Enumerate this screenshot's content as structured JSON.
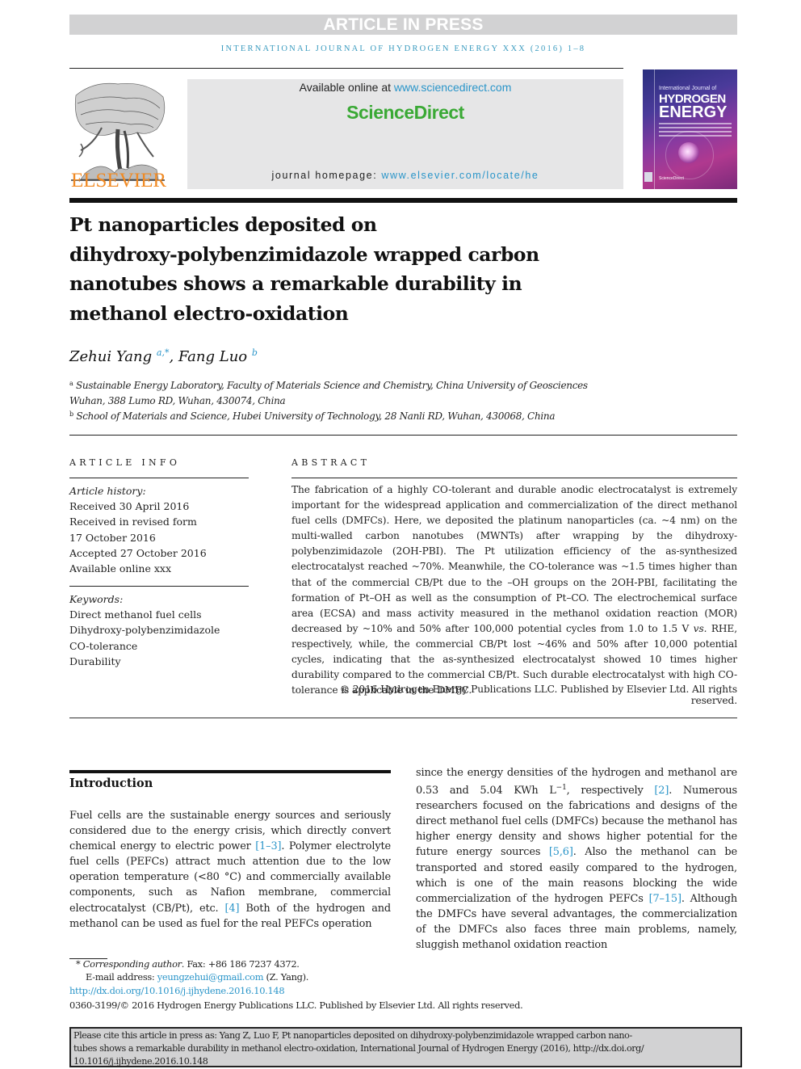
{
  "banner": {
    "text": "ARTICLE IN PRESS"
  },
  "running_header": {
    "text": "INTERNATIONAL JOURNAL OF HYDROGEN ENERGY XXX (2016) 1–8"
  },
  "publisher": {
    "logo_text": "ELSEVIER",
    "available_online_prefix": "Available online at ",
    "available_online_link": "www.sciencedirect.com",
    "brand": "ScienceDirect",
    "homepage_prefix": "journal homepage: ",
    "homepage_link": "www.elsevier.com/locate/he",
    "colors": {
      "elsevier_orange": "#f08a24",
      "sd_green": "#3aa935",
      "link_blue": "#2a95c9"
    }
  },
  "cover": {
    "small_title": "International Journal of",
    "big_title_1": "HYDROGEN",
    "big_title_2": "ENERGY",
    "footer": "ScienceDirect"
  },
  "article": {
    "title_lines": [
      "Pt nanoparticles deposited on",
      "dihydroxy-polybenzimidazole wrapped carbon",
      "nanotubes shows a remarkable durability in",
      "methanol electro-oxidation"
    ],
    "authors": [
      {
        "name": "Zehui Yang",
        "marks": "a,*"
      },
      {
        "name": "Fang Luo",
        "marks": "b"
      }
    ],
    "author_separator": ", ",
    "affiliations": [
      {
        "mark": "a",
        "line1": "Sustainable Energy Laboratory, Faculty of Materials Science and Chemistry, China University of Geosciences",
        "line2": "Wuhan, 388 Lumo RD, Wuhan, 430074, China"
      },
      {
        "mark": "b",
        "line1": "School of Materials and Science, Hubei University of Technology, 28 Nanli RD, Wuhan, 430068, China"
      }
    ]
  },
  "article_info": {
    "heading": "ARTICLE INFO",
    "history_label": "Article history:",
    "history": [
      "Received 30 April 2016",
      "Received in revised form",
      "17 October 2016",
      "Accepted 27 October 2016",
      "Available online xxx"
    ],
    "keywords_label": "Keywords:",
    "keywords": [
      "Direct methanol fuel cells",
      "Dihydroxy-polybenzimidazole",
      "CO-tolerance",
      "Durability"
    ]
  },
  "abstract": {
    "heading": "ABSTRACT",
    "part1": "The fabrication of a highly CO-tolerant and durable anodic electrocatalyst is extremely important for the widespread application and commercialization of the direct methanol fuel cells (DMFCs). Here, we deposited the platinum nanoparticles (ca. ~4 nm) on the multi-walled carbon nanotubes (MWNTs) after wrapping by the dihydroxy-polybenzimidazole (2OH-PBI). The Pt utilization efficiency of the as-synthesized electrocatalyst reached ~70%. Meanwhile, the CO-tolerance was ~1.5 times higher than that of the commercial CB/Pt due to the –OH groups on the 2OH-PBI, facilitating the formation of Pt–OH as well as the consumption of Pt–CO. The electrochemical surface area (ECSA) and mass activity measured in the methanol oxidation reaction (MOR) decreased by ~10% and 50% after 100,000 potential cycles from 1.0 to 1.5 V ",
    "vs": "vs.",
    "part2": " RHE, respectively, while, the commercial CB/Pt lost ~46% and 50% after 10,000 potential cycles, indicating that the as-synthesized electrocatalyst showed 10 times higher durability compared to the commercial CB/Pt. Such durable electrocatalyst with high CO-tolerance is applicable in the DMFC.",
    "copyright": "© 2016 Hydrogen Energy Publications LLC. Published by Elsevier Ltd. All rights reserved."
  },
  "introduction": {
    "heading": "Introduction",
    "left": {
      "t1": "Fuel cells are the sustainable energy sources and seriously considered due to the energy crisis, which directly convert chemical energy to electric power ",
      "r1": "[1–3]",
      "t2": ". Polymer electrolyte fuel cells (PEFCs) attract much attention due to the low operation temperature (<80 °C) and commercially available components, such as Nafion membrane, commercial electrocatalyst (CB/Pt), etc. ",
      "r2": "[4]",
      "t3": " Both of the hydrogen and methanol can be used as fuel for the real PEFCs operation"
    },
    "right": {
      "t1": "since the energy densities of the hydrogen and methanol are 0.53 and 5.04 KWh L",
      "sup": "−1",
      "t2": ", respectively ",
      "r1": "[2]",
      "t3": ". Numerous researchers focused on the fabrications and designs of the direct methanol fuel cells (DMFCs) because the methanol has higher energy density and shows higher potential for the future energy sources ",
      "r2": "[5,6]",
      "t4": ". Also the methanol can be transported and stored easily compared to the hydrogen, which is one of the main reasons blocking the wide commercialization of the hydrogen PEFCs ",
      "r3": "[7–15]",
      "t5": ". Although the DMFCs have several advantages, the commercialization of the DMFCs also faces three main problems, namely, sluggish methanol oxidation reaction"
    }
  },
  "footnotes": {
    "corresponding_mark": "*",
    "corresponding_label": "Corresponding author",
    "fax": ". Fax: +86 186 7237 4372.",
    "email_label": "E-mail address: ",
    "email": "yeungzehui@gmail.com",
    "email_suffix": " (Z. Yang).",
    "doi_link": "http://dx.doi.org/10.1016/j.ijhydene.2016.10.148",
    "issn_line": "0360-3199/© 2016 Hydrogen Energy Publications LLC. Published by Elsevier Ltd. All rights reserved."
  },
  "citation_box": {
    "line1": "Please cite this article in press as: Yang Z, Luo F, Pt nanoparticles deposited on dihydroxy-polybenzimidazole wrapped carbon nano-",
    "line2": "tubes shows a remarkable durability in methanol electro-oxidation, International Journal of Hydrogen Energy (2016), http://dx.doi.org/",
    "line3": "10.1016/j.ijhydene.2016.10.148"
  }
}
